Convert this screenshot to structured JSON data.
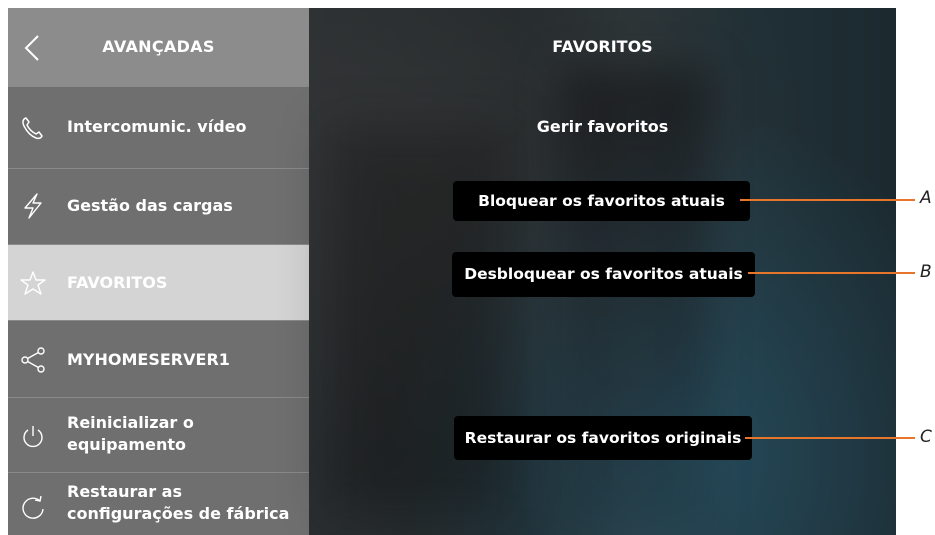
{
  "sidebar": {
    "header_title": "AVANÇADAS",
    "items": [
      {
        "label": "Intercomunic. vídeo",
        "icon": "phone-icon"
      },
      {
        "label": "Gestão das cargas",
        "icon": "lightning-icon"
      },
      {
        "label": "FAVORITOS",
        "icon": "star-icon",
        "active": true
      },
      {
        "label": "MYHOMESERVER1",
        "icon": "share-icon"
      },
      {
        "label": "Reinicializar o equipamento",
        "icon": "power-icon"
      },
      {
        "label": "Restaurar as configurações de fábrica",
        "icon": "reset-icon"
      }
    ]
  },
  "main": {
    "title": "FAVORITOS",
    "subtitle": "Gerir favoritos",
    "buttons": {
      "lock": "Bloquear os favoritos atuais",
      "unlock": "Desbloquear os favoritos atuais",
      "restore": "Restaurar os favoritos originais"
    }
  },
  "callouts": {
    "a": "A",
    "b": "B",
    "c": "C"
  },
  "colors": {
    "accent": "#e8762a",
    "sidebar": "#6f6f6f",
    "sidebar_header": "#8c8c8c",
    "active_item": "#d4d4d4"
  }
}
